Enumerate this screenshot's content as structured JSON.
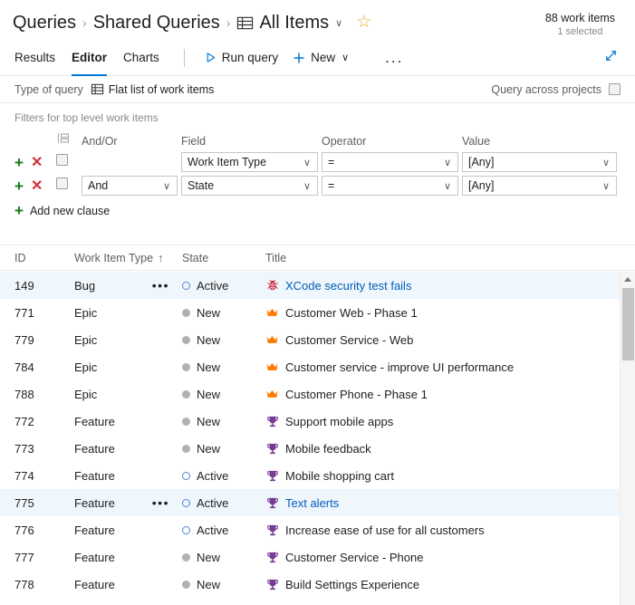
{
  "header": {
    "breadcrumb": [
      {
        "label": "Queries",
        "icon": null
      },
      {
        "label": "Shared Queries",
        "icon": null
      },
      {
        "label": "All Items",
        "icon": "grid-table-icon"
      }
    ],
    "separator": "›",
    "dropdown_chevron": "∨",
    "favorite_icon": "star-outline-icon",
    "favorite_glyph": "☆",
    "work_item_count": "88 work items",
    "selected_count": "1 selected"
  },
  "toolbar": {
    "pivots": [
      {
        "label": "Results",
        "selected": false
      },
      {
        "label": "Editor",
        "selected": true
      },
      {
        "label": "Charts",
        "selected": false
      }
    ],
    "run_query_label": "Run query",
    "run_query_icon": "play-triangle-icon",
    "new_label": "New",
    "new_icon": "plus-icon",
    "more_label": "...",
    "more_icon": "ellipsis-icon",
    "expand_icon": "expand-diagonal-arrows-icon"
  },
  "query_type": {
    "label": "Type of query",
    "value": "Flat list of work items",
    "value_icon": "flat-list-grid-icon",
    "across_projects_label": "Query across projects",
    "across_projects_checked": false
  },
  "filters": {
    "caption": "Filters for top level work items",
    "group_icon": "group-clauses-icon",
    "columns": {
      "andor": "And/Or",
      "field": "Field",
      "operator": "Operator",
      "value": "Value"
    },
    "add_icon": "plus-icon",
    "delete_icon": "close-x-icon",
    "chevron": "∨",
    "clauses": [
      {
        "andor": "",
        "field": "Work Item Type",
        "operator": "=",
        "value": "[Any]",
        "checked": false,
        "show_andor": false
      },
      {
        "andor": "And",
        "field": "State",
        "operator": "=",
        "value": "[Any]",
        "checked": false,
        "show_andor": true
      }
    ],
    "add_new_clause_label": "Add new clause"
  },
  "grid": {
    "columns": [
      {
        "label": "ID",
        "sorted": false
      },
      {
        "label": "Work Item Type",
        "sorted": true,
        "sort_glyph": "↑"
      },
      {
        "label": "State",
        "sorted": false
      },
      {
        "label": "Title",
        "sorted": false
      }
    ],
    "rows": [
      {
        "id": "149",
        "type": "Bug",
        "state": "Active",
        "title": "XCode security test fails",
        "icon": "bug-icon",
        "selected": true,
        "link": true,
        "has_menu": true
      },
      {
        "id": "771",
        "type": "Epic",
        "state": "New",
        "title": "Customer Web - Phase 1",
        "icon": "crown-icon",
        "selected": false,
        "link": false,
        "has_menu": false
      },
      {
        "id": "779",
        "type": "Epic",
        "state": "New",
        "title": "Customer Service - Web",
        "icon": "crown-icon",
        "selected": false,
        "link": false,
        "has_menu": false
      },
      {
        "id": "784",
        "type": "Epic",
        "state": "New",
        "title": "Customer service - improve UI performance",
        "icon": "crown-icon",
        "selected": false,
        "link": false,
        "has_menu": false
      },
      {
        "id": "788",
        "type": "Epic",
        "state": "New",
        "title": "Customer Phone - Phase 1",
        "icon": "crown-icon",
        "selected": false,
        "link": false,
        "has_menu": false
      },
      {
        "id": "772",
        "type": "Feature",
        "state": "New",
        "title": "Support mobile apps",
        "icon": "trophy-icon",
        "selected": false,
        "link": false,
        "has_menu": false
      },
      {
        "id": "773",
        "type": "Feature",
        "state": "New",
        "title": "Mobile feedback",
        "icon": "trophy-icon",
        "selected": false,
        "link": false,
        "has_menu": false
      },
      {
        "id": "774",
        "type": "Feature",
        "state": "Active",
        "title": "Mobile shopping cart",
        "icon": "trophy-icon",
        "selected": false,
        "link": false,
        "has_menu": false
      },
      {
        "id": "775",
        "type": "Feature",
        "state": "Active",
        "title": "Text alerts",
        "icon": "trophy-icon",
        "selected": true,
        "link": true,
        "has_menu": true
      },
      {
        "id": "776",
        "type": "Feature",
        "state": "Active",
        "title": "Increase ease of use for all customers",
        "icon": "trophy-icon",
        "selected": false,
        "link": false,
        "has_menu": false
      },
      {
        "id": "777",
        "type": "Feature",
        "state": "New",
        "title": "Customer Service - Phone",
        "icon": "trophy-icon",
        "selected": false,
        "link": false,
        "has_menu": false
      },
      {
        "id": "778",
        "type": "Feature",
        "state": "New",
        "title": "Build Settings Experience",
        "icon": "trophy-icon",
        "selected": false,
        "link": false,
        "has_menu": false
      }
    ],
    "row_menu_glyph": "•••"
  },
  "colors": {
    "accent": "#0078d4",
    "link": "#005eb8",
    "selected_row": "#eff6fc",
    "bug": "#cc293d",
    "epic": "#ff7b00",
    "feature": "#773b93",
    "state_active": "#5087d6",
    "state_new": "#b1b1b1",
    "add": "#107c10",
    "delete": "#d13438",
    "favorite": "#f0ad2b"
  }
}
